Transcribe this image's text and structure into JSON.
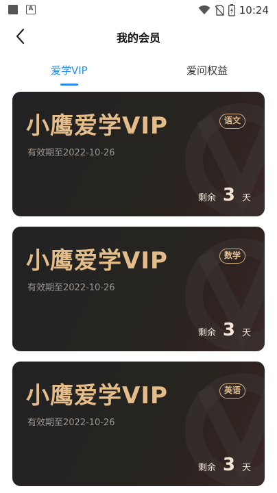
{
  "status_bar": {
    "time": "10:24"
  },
  "header": {
    "title": "我的会员"
  },
  "tabs": [
    {
      "label": "爱学VIP"
    },
    {
      "label": "爱问权益"
    }
  ],
  "cards": [
    {
      "title": "小鹰爱学VIP",
      "subject": "语文",
      "expire": "有效期至2022-10-26",
      "remain_prefix": "剩余",
      "remain_days": "3",
      "remain_suffix": "天"
    },
    {
      "title": "小鹰爱学VIP",
      "subject": "数学",
      "expire": "有效期至2022-10-26",
      "remain_prefix": "剩余",
      "remain_days": "3",
      "remain_suffix": "天"
    },
    {
      "title": "小鹰爱学VIP",
      "subject": "英语",
      "expire": "有效期至2022-10-26",
      "remain_prefix": "剩余",
      "remain_days": "3",
      "remain_suffix": "天"
    }
  ],
  "colors": {
    "accent": "#2a8cf0",
    "gold": "#e5bd8b",
    "card_bg": "#232325"
  }
}
